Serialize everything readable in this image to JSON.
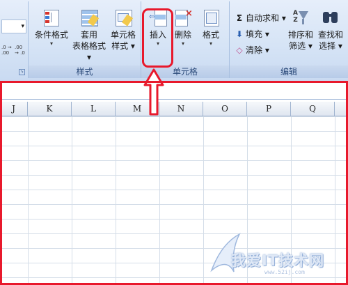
{
  "ribbon": {
    "partial_left": {
      "dropdown_arrow": "▾",
      "decimals": [
        ".0 → .00",
        ".00 → .0"
      ]
    },
    "style_group": {
      "label": "样式",
      "buttons": [
        {
          "line1": "条件格式",
          "line2": "▾",
          "icon": "conditional-format-icon"
        },
        {
          "line1": "套用",
          "line2": "表格格式 ▾",
          "icon": "table-format-icon"
        },
        {
          "line1": "单元格",
          "line2": "样式 ▾",
          "icon": "cell-style-icon"
        }
      ]
    },
    "cells_group": {
      "label": "单元格",
      "buttons": [
        {
          "label": "插入",
          "dropdown": "▾",
          "icon": "insert-cells-icon"
        },
        {
          "label": "删除",
          "dropdown": "▾",
          "icon": "delete-cells-icon"
        },
        {
          "label": "格式",
          "dropdown": "▾",
          "icon": "format-cells-icon"
        }
      ]
    },
    "edit_group": {
      "label": "编辑",
      "small_buttons": [
        {
          "label": "自动求和 ▾",
          "icon_glyph": "Σ",
          "icon": "autosum-icon"
        },
        {
          "label": "填充 ▾",
          "icon_glyph": "⬇",
          "icon": "fill-icon"
        },
        {
          "label": "清除 ▾",
          "icon_glyph": "◇",
          "icon": "clear-icon"
        }
      ],
      "big_buttons": [
        {
          "line1": "排序和",
          "line2": "筛选 ▾",
          "icon": "sort-filter-icon"
        },
        {
          "line1": "查找和",
          "line2": "选择 ▾",
          "icon": "find-select-icon"
        }
      ]
    }
  },
  "columns": [
    "J",
    "K",
    "L",
    "M",
    "N",
    "O",
    "P",
    "Q"
  ],
  "watermark": {
    "text": "我爱IT技术网",
    "sub": "www.52ij.com"
  },
  "colors": {
    "highlight": "#e8192c",
    "ribbon": "#d6e4f6",
    "grid": "#d4dde8"
  }
}
